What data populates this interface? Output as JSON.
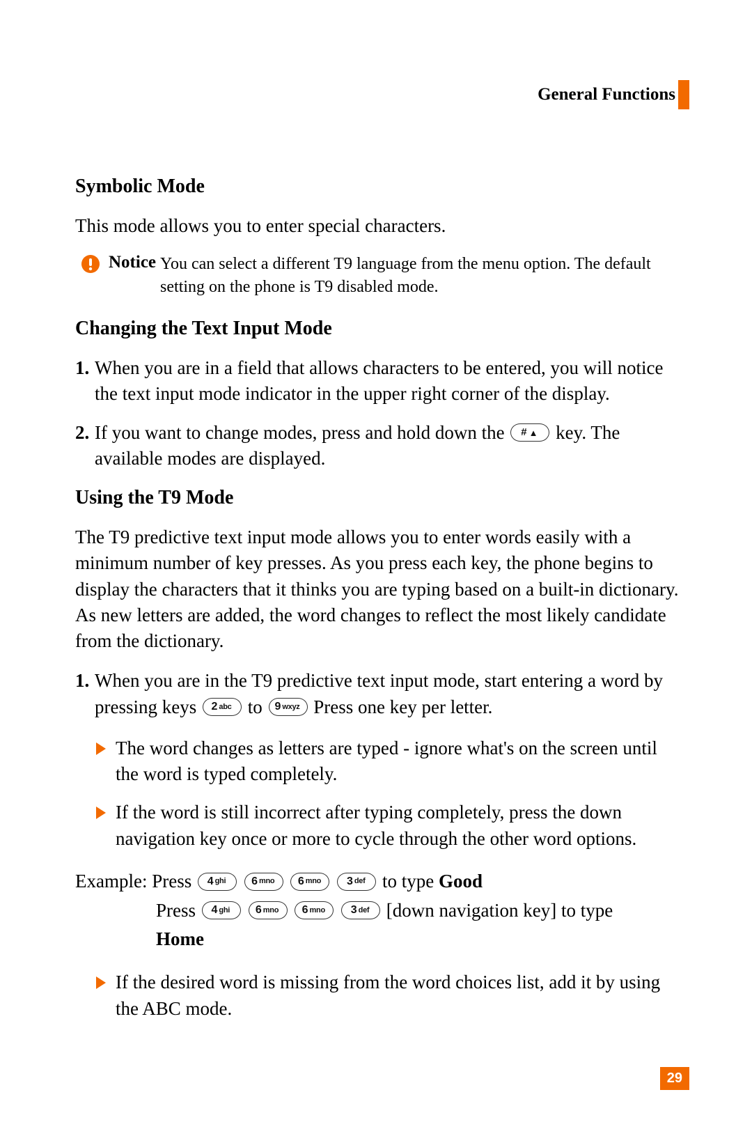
{
  "header": {
    "title": "General Functions"
  },
  "sections": {
    "symbolic": {
      "title": "Symbolic Mode",
      "body": "This mode allows you to enter special characters."
    },
    "notice": {
      "label": "Notice",
      "text": "You can select a different T9 language from the menu option. The default setting on the phone is T9 disabled mode."
    },
    "changing": {
      "title": "Changing the Text Input Mode",
      "items": [
        "When you are in a field that allows characters to be entered, you will notice the text input mode indicator in the upper right corner of the display.",
        {
          "pre": "If you want to change modes, press and hold down the ",
          "key": {
            "label": "#",
            "sub": "↑"
          },
          "post": " key. The available modes are displayed."
        }
      ]
    },
    "t9": {
      "title": "Using the T9 Mode",
      "intro": "The T9 predictive text input mode allows you to enter words easily with a minimum number of key presses. As you press each key, the phone begins to display the characters that it thinks you are typing based on a built-in dictionary. As new letters are added, the word changes to reflect the most likely candidate from the dictionary.",
      "item1": {
        "pre": "When you are in the T9 predictive text input mode, start entering a word by pressing keys ",
        "key1": {
          "big": "2",
          "sm": "abc"
        },
        "mid": " to ",
        "key2": {
          "big": "9",
          "sm": "wxyz"
        },
        "post": " Press one key per letter."
      },
      "bullets": [
        "The word changes as letters are typed - ignore what's on the screen until the word is typed completely.",
        "If the word is still incorrect after typing completely, press the down navigation key once or more to cycle through the other word options."
      ],
      "example": {
        "label": "Example:",
        "line1_pre": " Press ",
        "keys1": [
          {
            "big": "4",
            "sm": "ghi"
          },
          {
            "big": "6",
            "sm": "mno"
          },
          {
            "big": "6",
            "sm": "mno"
          },
          {
            "big": "3",
            "sm": "def"
          }
        ],
        "line1_mid": " to type ",
        "line1_word": "Good",
        "line2_pre": "Press ",
        "keys2": [
          {
            "big": "4",
            "sm": "ghi"
          },
          {
            "big": "6",
            "sm": "mno"
          },
          {
            "big": "6",
            "sm": "mno"
          },
          {
            "big": "3",
            "sm": "def"
          }
        ],
        "line2_post": " [down navigation key] to type ",
        "line2_word": "Home"
      },
      "bullet3": "If the desired word is missing from the word choices list, add it by using the ABC mode."
    }
  },
  "page_number": "29"
}
